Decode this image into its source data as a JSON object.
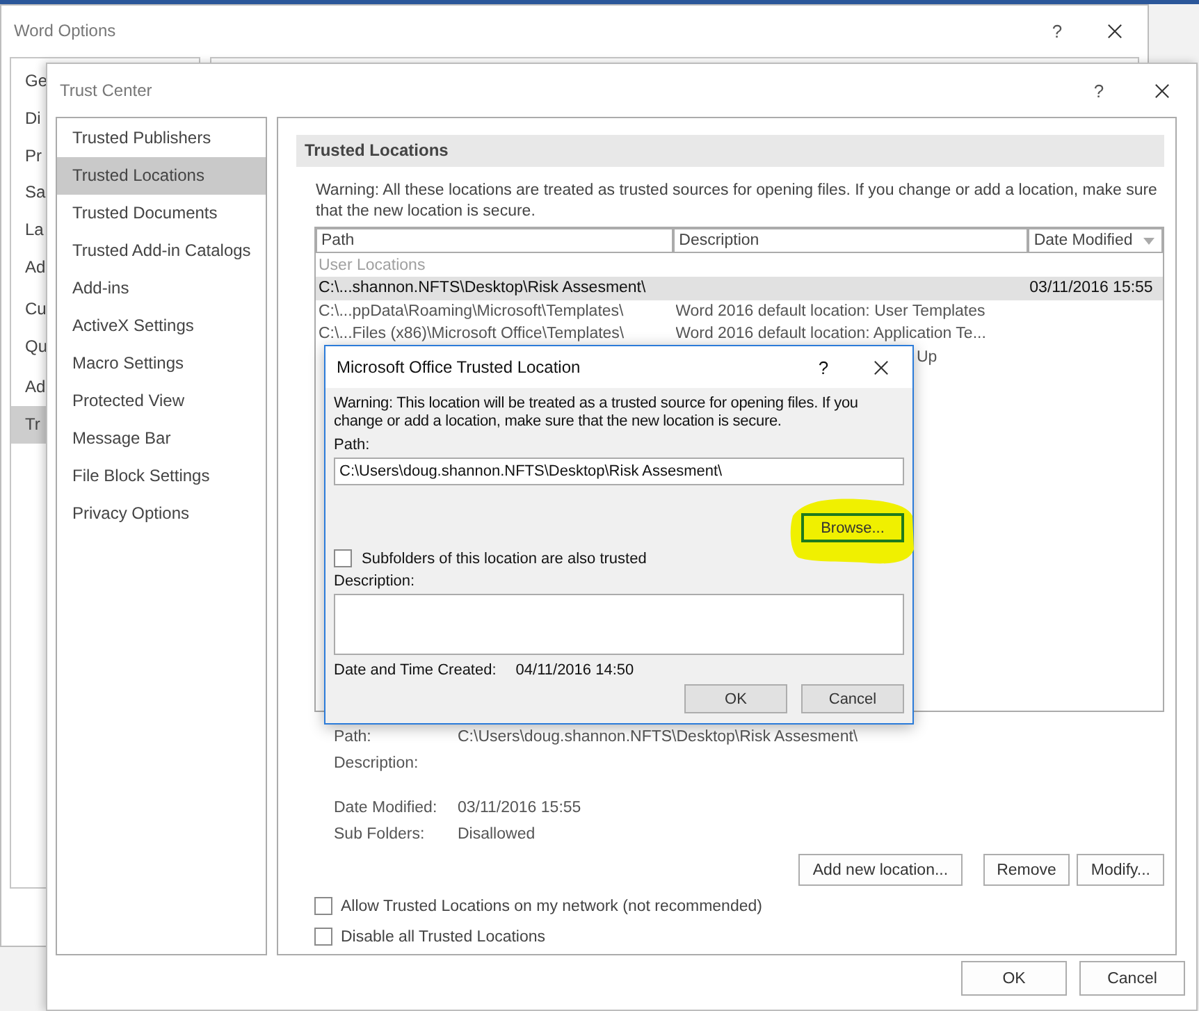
{
  "word_options": {
    "title": "Word Options",
    "help": "?",
    "sidebar_items": [
      {
        "label": "Ge",
        "selected": false
      },
      {
        "label": "Di",
        "selected": false
      },
      {
        "label": "Pr",
        "selected": false
      },
      {
        "label": "Sa",
        "selected": false
      },
      {
        "label": "La",
        "selected": false
      },
      {
        "label": "Ad",
        "selected": false
      },
      {
        "label": "Cu",
        "selected": false
      },
      {
        "label": "Qu",
        "selected": false
      },
      {
        "label": "Ad",
        "selected": false
      },
      {
        "label": "Tr",
        "selected": true
      }
    ]
  },
  "trust_center": {
    "title": "Trust Center",
    "help": "?",
    "sidebar_items": [
      {
        "label": "Trusted Publishers",
        "selected": false
      },
      {
        "label": "Trusted Locations",
        "selected": true
      },
      {
        "label": "Trusted Documents",
        "selected": false
      },
      {
        "label": "Trusted Add-in Catalogs",
        "selected": false
      },
      {
        "label": "Add-ins",
        "selected": false
      },
      {
        "label": "ActiveX Settings",
        "selected": false
      },
      {
        "label": "Macro Settings",
        "selected": false
      },
      {
        "label": "Protected View",
        "selected": false
      },
      {
        "label": "Message Bar",
        "selected": false
      },
      {
        "label": "File Block Settings",
        "selected": false
      },
      {
        "label": "Privacy Options",
        "selected": false
      }
    ],
    "section_title": "Trusted Locations",
    "warning": "Warning: All these locations are treated as trusted sources for opening files.  If you change or add a location, make sure that the new location is secure.",
    "table": {
      "columns": [
        {
          "label": "Path",
          "sorted": false
        },
        {
          "label": "Description",
          "sorted": false
        },
        {
          "label": "Date Modified",
          "sorted": true
        }
      ],
      "group_label": "User Locations",
      "rows": [
        {
          "kind": "full",
          "path": "C:\\...shannon.NFTS\\Desktop\\Risk Assesment\\",
          "date": "03/11/2016 15:55",
          "selected": true
        },
        {
          "kind": "full",
          "path": "C:\\...ppData\\Roaming\\Microsoft\\Templates\\",
          "description": "Word 2016 default location: User Templates",
          "selected": false
        },
        {
          "kind": "full",
          "path": "C:\\...Files (x86)\\Microsoft Office\\Templates\\",
          "description": "Word 2016 default location: Application Te...",
          "selected": false
        },
        {
          "kind": "partial",
          "description": "Up",
          "selected": false
        }
      ]
    },
    "details": [
      {
        "label": "Path:",
        "value": "C:\\Users\\doug.shannon.NFTS\\Desktop\\Risk Assesment\\"
      },
      {
        "label": "Description:"
      },
      {
        "label": "Date Modified:",
        "value": "03/11/2016 15:55"
      },
      {
        "label": "Sub Folders:",
        "value": "Disallowed"
      }
    ],
    "location_buttons": [
      "Add new location...",
      "Remove",
      "Modify..."
    ],
    "options": [
      {
        "label": "Allow Trusted Locations on my network (not recommended)",
        "checked": false
      },
      {
        "label": "Disable all Trusted Locations",
        "checked": false
      }
    ],
    "footer_buttons": [
      "OK",
      "Cancel"
    ]
  },
  "dialog": {
    "title": "Microsoft Office Trusted Location",
    "help": "?",
    "warning": "Warning: This location will be treated as a trusted source for opening files. If you change or add a location, make sure that the new location is secure.",
    "path_label": "Path:",
    "path_value": "C:\\Users\\doug.shannon.NFTS\\Desktop\\Risk Assesment\\",
    "browse_button": {
      "label": "Browse...",
      "highlighted": true
    },
    "subfolders": {
      "label": "Subfolders of this location are also trusted",
      "checked": false
    },
    "description_label": "Description:",
    "created_label": "Date and Time Created:",
    "created_value": "04/11/2016 14:50",
    "buttons": [
      "OK",
      "Cancel"
    ]
  }
}
